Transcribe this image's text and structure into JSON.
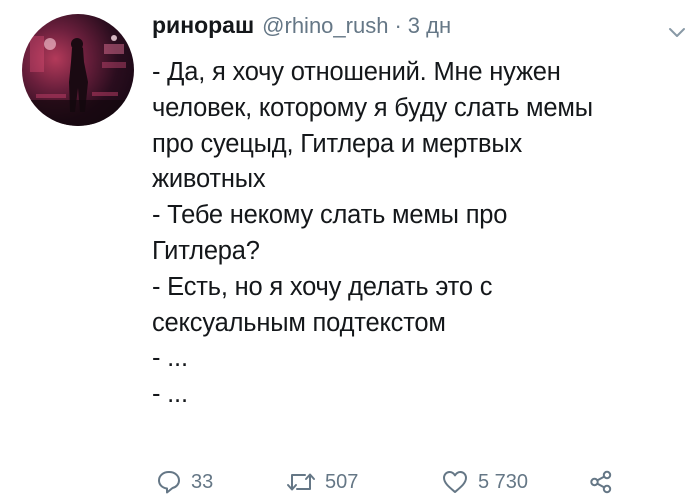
{
  "tweet": {
    "display_name": "ринораш",
    "handle": "@rhino_rush",
    "separator": "·",
    "time": "3 дн",
    "lines": [
      "- Да, я хочу отношений. Мне нужен",
      "человек, которому я буду слать мемы",
      "про суецыд, Гитлера и мертвых",
      "животных",
      "- Тебе некому слать мемы про",
      "Гитлера?",
      "- Есть, но я хочу делать это с",
      "сексуальным подтекстом",
      "- ...",
      "- ..."
    ],
    "actions": {
      "reply_count": "33",
      "retweet_count": "507",
      "like_count": "5 730"
    },
    "icons": {
      "reply": "reply-icon",
      "retweet": "retweet-icon",
      "like": "heart-icon",
      "share": "share-icon",
      "menu": "chevron-down-icon"
    },
    "colors": {
      "text": "#14171a",
      "muted": "#657786"
    }
  }
}
